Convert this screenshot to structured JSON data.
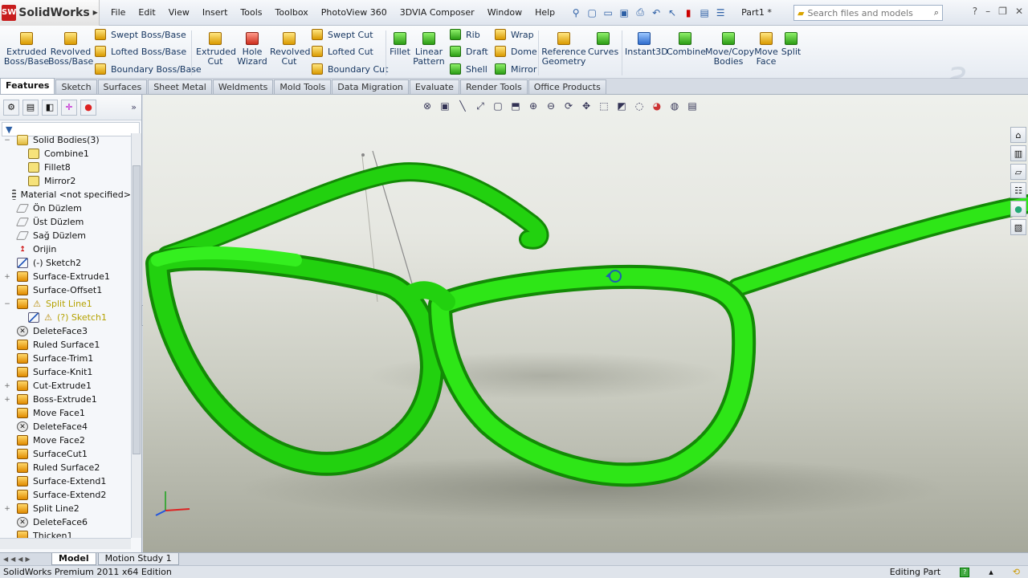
{
  "app": {
    "brand": "SolidWorks",
    "doc_title": "Part1 *"
  },
  "menu": [
    "File",
    "Edit",
    "View",
    "Insert",
    "Tools",
    "Toolbox",
    "PhotoView 360",
    "3DVIA Composer",
    "Window",
    "Help"
  ],
  "search": {
    "placeholder": "Search files and models"
  },
  "commands": {
    "extruded_boss": "Extruded Boss/Base",
    "revolved_boss": "Revolved Boss/Base",
    "swept_boss": "Swept Boss/Base",
    "lofted_boss": "Lofted Boss/Base",
    "boundary_boss": "Boundary Boss/Base",
    "extruded_cut": "Extruded Cut",
    "hole_wizard": "Hole Wizard",
    "revolved_cut": "Revolved Cut",
    "swept_cut": "Swept Cut",
    "lofted_cut": "Lofted Cut",
    "boundary_cut": "Boundary Cut",
    "fillet": "Fillet",
    "linear_pattern": "Linear Pattern",
    "rib": "Rib",
    "draft": "Draft",
    "shell": "Shell",
    "wrap": "Wrap",
    "dome": "Dome",
    "mirror": "Mirror",
    "reference_geometry": "Reference Geometry",
    "curves": "Curves",
    "instant3d": "Instant3D",
    "combine": "Combine",
    "move_copy_bodies": "Move/Copy Bodies",
    "move_face": "Move Face",
    "split": "Split"
  },
  "tabs": [
    "Features",
    "Sketch",
    "Surfaces",
    "Sheet Metal",
    "Weldments",
    "Mold Tools",
    "Data Migration",
    "Evaluate",
    "Render Tools",
    "Office Products"
  ],
  "tree": [
    {
      "label": "Solid Bodies(3)",
      "icon": "folder",
      "expand": "−"
    },
    {
      "label": "Combine1",
      "icon": "body",
      "indent": 1
    },
    {
      "label": "Fillet8",
      "icon": "body",
      "indent": 1
    },
    {
      "label": "Mirror2",
      "icon": "body",
      "indent": 1
    },
    {
      "label": "Material <not specified>",
      "icon": "material"
    },
    {
      "label": "Ön Düzlem",
      "icon": "plane"
    },
    {
      "label": "Üst Düzlem",
      "icon": "plane"
    },
    {
      "label": "Sağ Düzlem",
      "icon": "plane"
    },
    {
      "label": "Orijin",
      "icon": "origin"
    },
    {
      "label": "(-) Sketch2",
      "icon": "sketch"
    },
    {
      "label": "Surface-Extrude1",
      "icon": "feature",
      "expand": "+"
    },
    {
      "label": "Surface-Offset1",
      "icon": "feature"
    },
    {
      "label": "Split Line1",
      "icon": "feature",
      "expand": "−",
      "warning": true
    },
    {
      "label": "(?) Sketch1",
      "icon": "sketch",
      "indent": 1,
      "warning": true
    },
    {
      "label": "DeleteFace3",
      "icon": "delete"
    },
    {
      "label": "Ruled Surface1",
      "icon": "feature"
    },
    {
      "label": "Surface-Trim1",
      "icon": "feature"
    },
    {
      "label": "Surface-Knit1",
      "icon": "feature"
    },
    {
      "label": "Cut-Extrude1",
      "icon": "feature",
      "expand": "+"
    },
    {
      "label": "Boss-Extrude1",
      "icon": "feature",
      "expand": "+"
    },
    {
      "label": "Move Face1",
      "icon": "feature"
    },
    {
      "label": "DeleteFace4",
      "icon": "delete"
    },
    {
      "label": "Move Face2",
      "icon": "feature"
    },
    {
      "label": "SurfaceCut1",
      "icon": "feature"
    },
    {
      "label": "Ruled Surface2",
      "icon": "feature"
    },
    {
      "label": "Surface-Extend1",
      "icon": "feature"
    },
    {
      "label": "Surface-Extend2",
      "icon": "feature"
    },
    {
      "label": "Split Line2",
      "icon": "feature",
      "expand": "+"
    },
    {
      "label": "DeleteFace6",
      "icon": "delete"
    },
    {
      "label": "Thicken1",
      "icon": "feature"
    }
  ],
  "bottom_tabs": [
    "Model",
    "Motion Study 1"
  ],
  "status": {
    "edition": "SolidWorks Premium 2011 x64 Edition",
    "mode": "Editing Part"
  },
  "colors": {
    "model": "#22d10f",
    "model_dark": "#138a06",
    "brand_red": "#c81d1d"
  }
}
